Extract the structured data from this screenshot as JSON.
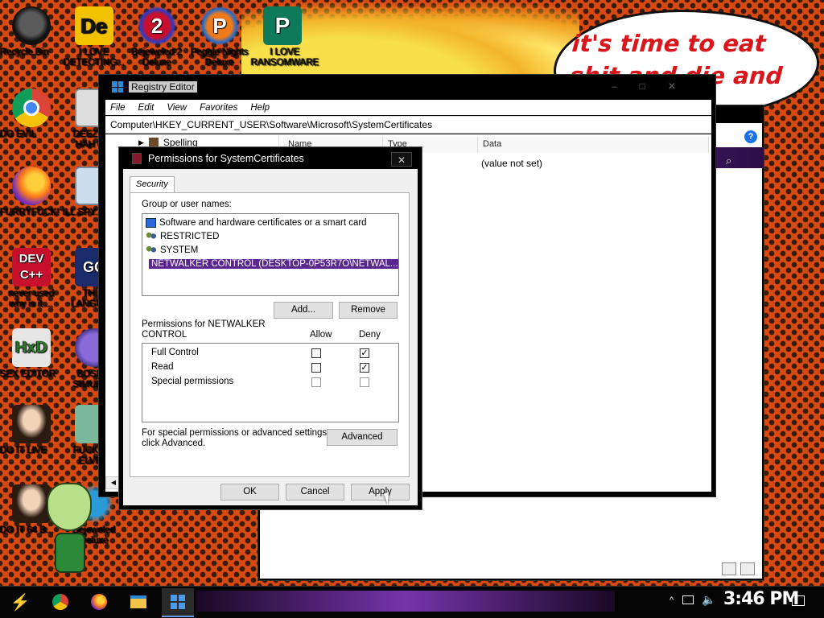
{
  "wallpaper": {
    "speech_text": "it's time to eat shit and die and chew"
  },
  "desktop_icons": [
    {
      "label": "Recycle Bin",
      "icon": "recycle-bin-icon"
    },
    {
      "label": "I LOVE DETECTING...",
      "icon": "detect-it-easy-icon"
    },
    {
      "label": "Bejeweled 2 Deluxe",
      "icon": "bejeweled-icon"
    },
    {
      "label": "Peggle Nights Deluxe",
      "icon": "peggle-icon"
    },
    {
      "label": "I LOVE RANSOMWARE",
      "icon": "publisher-icon"
    },
    {
      "label": "DO EVIL",
      "icon": "chrome-icon"
    },
    {
      "label": "DEEZ N... HAH G...",
      "icon": "app-icon"
    },
    {
      "label": "FURRYFUCK!",
      "icon": "firefox-icon"
    },
    {
      "label": "ILL SPY... YOU",
      "icon": "app-icon"
    },
    {
      "label": "never used why is it ...",
      "icon": "devcpp-icon"
    },
    {
      "label": "THI... LANGUA...",
      "icon": "go-icon"
    },
    {
      "label": "SEX EDITOR",
      "icon": "hxd-icon"
    },
    {
      "label": "BOSN... SIMULA...",
      "icon": "app-icon"
    },
    {
      "label": "DO IT LIVE",
      "icon": "portrait-icon"
    },
    {
      "label": "FUCK S... ELVE...",
      "icon": "app-icon"
    },
    {
      "label": "DO IT 64 B...",
      "icon": "portrait-icon"
    },
    {
      "label": "Bejeweled Deluxe",
      "icon": "bejeweled-icon"
    }
  ],
  "regedit": {
    "title": "Registry Editor",
    "menu": [
      "File",
      "Edit",
      "View",
      "Favorites",
      "Help"
    ],
    "address": "Computer\\HKEY_CURRENT_USER\\Software\\Microsoft\\SystemCertificates",
    "tree_item": "Spelling",
    "columns": {
      "name": "Name",
      "type": "Type",
      "data": "Data"
    },
    "value_data": "(value not set)"
  },
  "dialog": {
    "title": "Permissions for SystemCertificates",
    "tab": "Security",
    "group_label": "Group or user names:",
    "users": [
      {
        "name": "Software and hardware certificates or a smart card",
        "icon": "certificate-icon"
      },
      {
        "name": "RESTRICTED",
        "icon": "users-group-icon"
      },
      {
        "name": "SYSTEM",
        "icon": "users-group-icon"
      },
      {
        "name": "NETWALKER CONTROL (DESKTOP-0P53R7O\\NETWAL...",
        "icon": "user-icon",
        "selected": true
      }
    ],
    "add_label": "Add...",
    "remove_label": "Remove",
    "perm_for_line1": "Permissions for NETWALKER",
    "perm_for_line2": "CONTROL",
    "allow_header": "Allow",
    "deny_header": "Deny",
    "permissions": [
      {
        "name": "Full Control",
        "allow": false,
        "deny": true
      },
      {
        "name": "Read",
        "allow": false,
        "deny": true
      },
      {
        "name": "Special permissions",
        "allow": false,
        "deny": false,
        "disabled": true
      }
    ],
    "advanced_text_line1": "For special permissions or advanced settings,",
    "advanced_text_line2": "click Advanced.",
    "advanced_label": "Advanced",
    "ok_label": "OK",
    "cancel_label": "Cancel",
    "apply_label": "Apply"
  },
  "taskbar": {
    "clock": "3:46 PM",
    "pinned": [
      "start-icon",
      "chrome-icon",
      "firefox-icon",
      "file-explorer-icon",
      "regedit-icon"
    ],
    "tray": [
      "chevron-up-icon",
      "network-icon",
      "volume-icon",
      "notification-icon"
    ]
  }
}
